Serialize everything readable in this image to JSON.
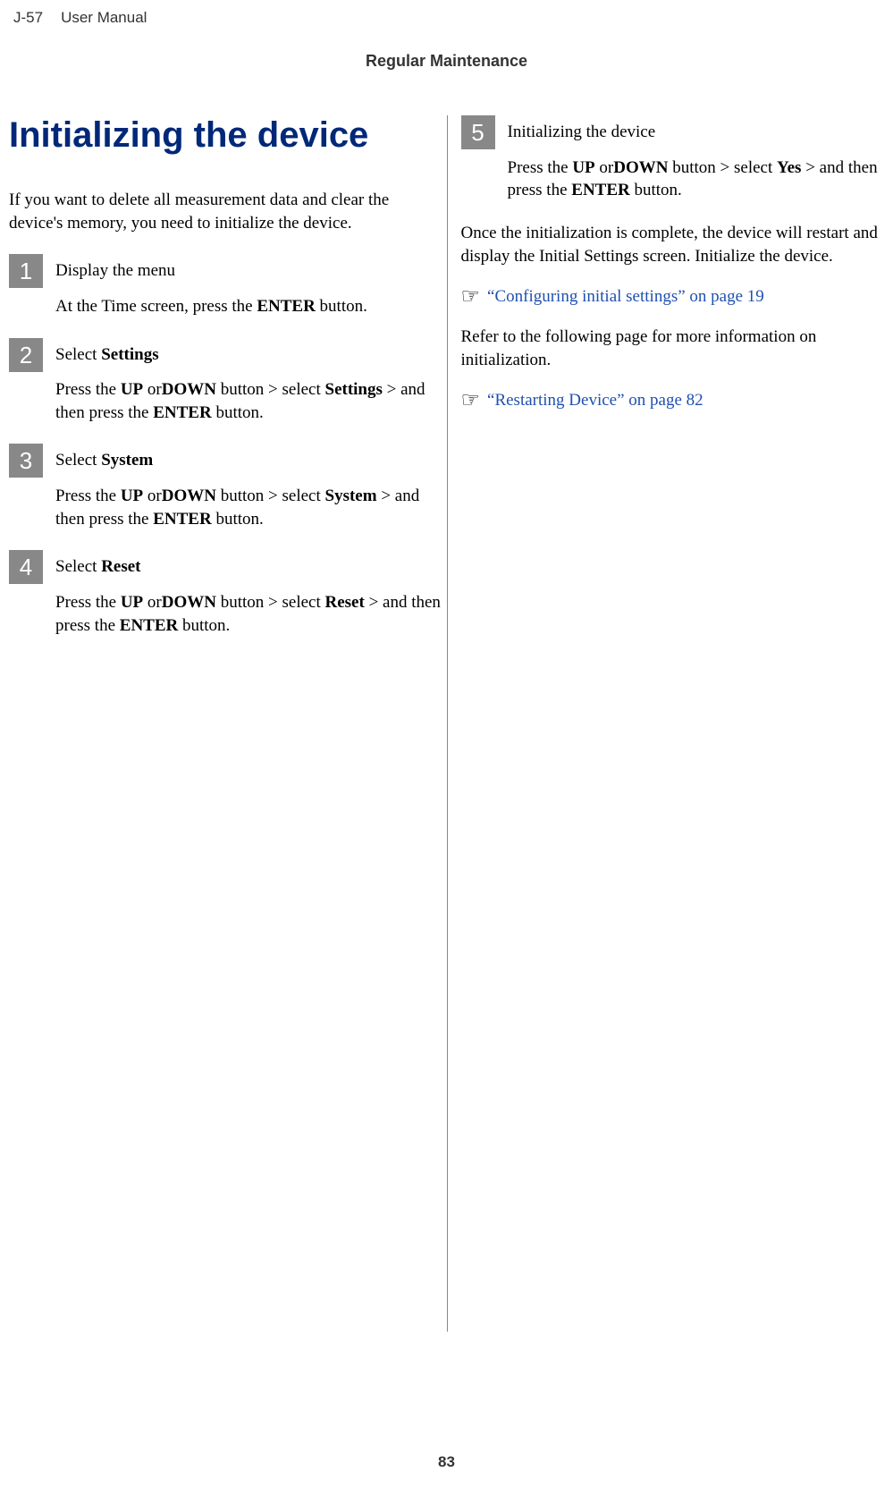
{
  "header": {
    "model": "J-57",
    "title": "User Manual",
    "section": "Regular Maintenance"
  },
  "main": {
    "heading": "Initializing the device",
    "intro": "If you want to delete all measurement data and clear the device's memory, you need to initialize the device."
  },
  "steps": {
    "s1": {
      "num": "1",
      "title": "Display the menu",
      "desc_pre": "At the Time screen, press the ",
      "btn": "ENTER",
      "desc_post": " button."
    },
    "s2": {
      "num": "2",
      "title_pre": "Select ",
      "title_bold": "Settings",
      "p1": "Press the ",
      "up": "UP",
      "or": " or",
      "down": "DOWN",
      "p2": " button > select ",
      "sel": "Settings",
      "p3": " > and then press the ",
      "enter": "ENTER",
      "p4": " button."
    },
    "s3": {
      "num": "3",
      "title_pre": "Select ",
      "title_bold": "System",
      "p1": "Press the ",
      "up": "UP",
      "or": " or",
      "down": "DOWN",
      "p2": " button > select ",
      "sel": "System",
      "p3": " > and then press the ",
      "enter": "ENTER",
      "p4": " button."
    },
    "s4": {
      "num": "4",
      "title_pre": "Select ",
      "title_bold": "Reset",
      "p1": "Press the ",
      "up": "UP",
      "or": " or",
      "down": "DOWN",
      "p2": " button > select ",
      "sel": "Reset",
      "p3": " > and then press the ",
      "enter": "ENTER",
      "p4": " button."
    },
    "s5": {
      "num": "5",
      "title": "Initializing the device",
      "p1": "Press the ",
      "up": "UP",
      "or": " or",
      "down": "DOWN",
      "p2": " button > select ",
      "sel": "Yes",
      "p3": " > and then press the ",
      "enter": "ENTER",
      "p4": " button."
    }
  },
  "right": {
    "complete": "Once the initialization is complete, the device will restart and display the Initial Settings screen. Initialize the device.",
    "xref1": "“Configuring initial settings” on page 19",
    "refer": "Refer to the following page for more information on initialization.",
    "xref2": "“Restarting Device” on page 82"
  },
  "icons": {
    "hand": "☞"
  },
  "page_number": "83"
}
